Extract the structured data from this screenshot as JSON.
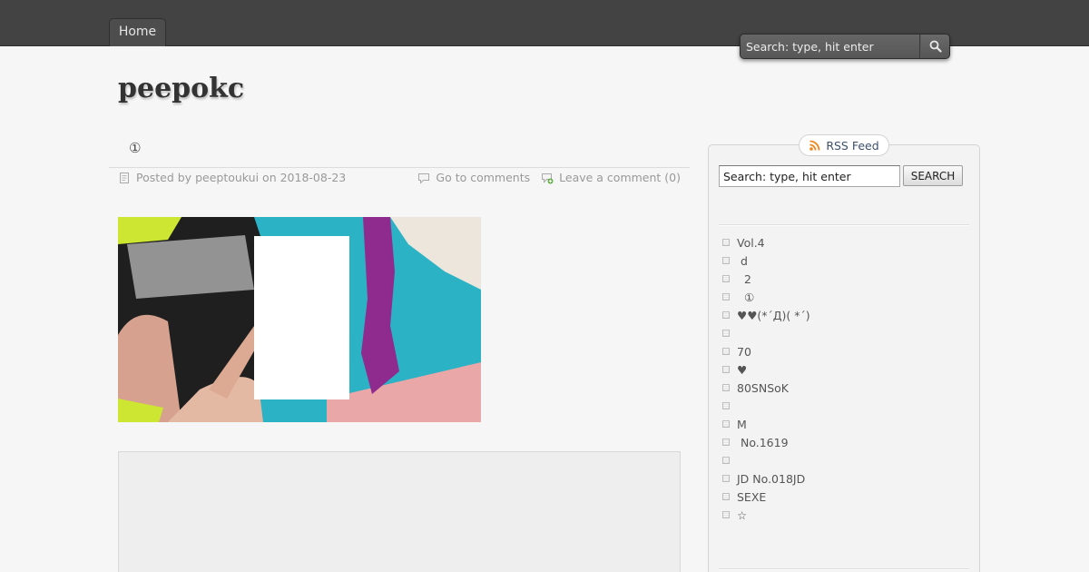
{
  "nav": {
    "home_label": "Home"
  },
  "top_search": {
    "placeholder": "Search: type, hit enter"
  },
  "site": {
    "title": "peepokc"
  },
  "post": {
    "title": "①",
    "meta_prefix": "Posted by",
    "author": "peeptoukui",
    "meta_on": "on",
    "date": "2018-08-23",
    "goto_comments": "Go to comments",
    "leave_comment": "Leave a comment (0)"
  },
  "sidebar": {
    "rss_label": "RSS Feed",
    "search_value": "Search: type, hit enter",
    "search_button": "SEARCH",
    "categories": [
      {
        "label": "Vol.4"
      },
      {
        "label": " d"
      },
      {
        "label": "  2"
      },
      {
        "label": "  ①"
      },
      {
        "label": "♥♥(*´Д)( *´)"
      },
      {
        "label": ""
      },
      {
        "label": "70"
      },
      {
        "label": "♥"
      },
      {
        "label": "80SNSoK"
      },
      {
        "label": ""
      },
      {
        "label": "M"
      },
      {
        "label": " No.1619"
      },
      {
        "label": ""
      },
      {
        "label": "JD No.018JD"
      },
      {
        "label": "SEXE"
      },
      {
        "label": "☆"
      }
    ]
  },
  "colors": {
    "topbar": "#434343",
    "background": "#f6f6f6",
    "accent_link": "#3d4f6a",
    "rss_orange": "#f0861e"
  }
}
